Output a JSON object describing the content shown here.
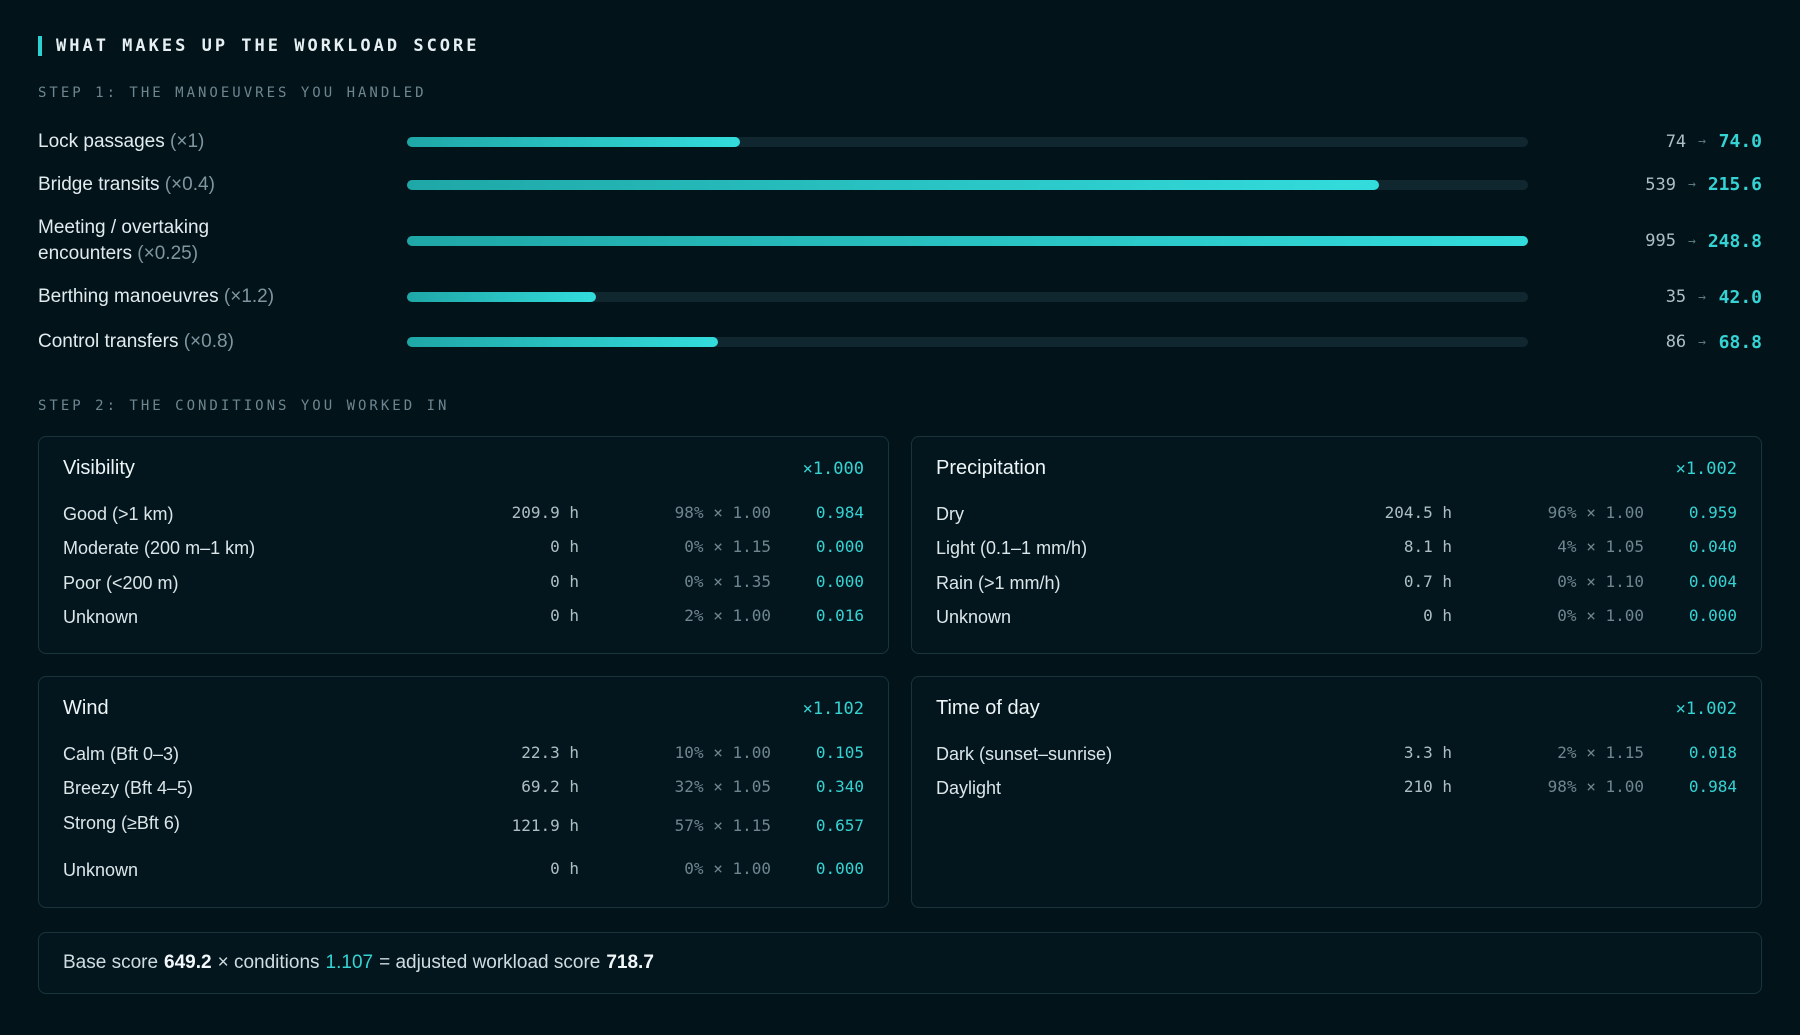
{
  "header": {
    "title": "WHAT MAKES UP THE WORKLOAD SCORE"
  },
  "step1": {
    "label": "STEP 1: THE MANOEUVRES YOU HANDLED",
    "items": [
      {
        "name": "Lock passages",
        "mult": "(×1)",
        "count": "74",
        "result": "74.0",
        "fill_fraction": 0.297
      },
      {
        "name": "Bridge transits",
        "mult": "(×0.4)",
        "count": "539",
        "result": "215.6",
        "fill_fraction": 0.867
      },
      {
        "name": "Meeting / overtaking",
        "name2": "encounters",
        "mult": "(×0.25)",
        "count": "995",
        "result": "248.8",
        "fill_fraction": 1.0
      },
      {
        "name": "Berthing manoeuvres",
        "mult": "(×1.2)",
        "count": "35",
        "result": "42.0",
        "fill_fraction": 0.169
      },
      {
        "name": "Control transfers",
        "mult": "(×0.8)",
        "count": "86",
        "result": "68.8",
        "fill_fraction": 0.277
      }
    ],
    "arrow_glyph": "→"
  },
  "step2": {
    "label": "STEP 2: THE CONDITIONS YOU WORKED IN",
    "cards": [
      {
        "title": "Visibility",
        "multiplier": "×1.000",
        "rows": [
          {
            "label": "Good (>1 km)",
            "hours": "209.9 h",
            "share": "98% × 1.00",
            "value": "0.984"
          },
          {
            "label": "Moderate (200 m–1 km)",
            "hours": "0 h",
            "share": "0% × 1.15",
            "value": "0.000"
          },
          {
            "label": "Poor (<200 m)",
            "hours": "0 h",
            "share": "0% × 1.35",
            "value": "0.000"
          },
          {
            "label": "Unknown",
            "hours": "0 h",
            "share": "2% × 1.00",
            "value": "0.016"
          }
        ]
      },
      {
        "title": "Precipitation",
        "multiplier": "×1.002",
        "rows": [
          {
            "label": "Dry",
            "hours": "204.5 h",
            "share": "96% × 1.00",
            "value": "0.959"
          },
          {
            "label": "Light (0.1–1 mm/h)",
            "hours": "8.1 h",
            "share": "4% × 1.05",
            "value": "0.040"
          },
          {
            "label": "Rain (>1 mm/h)",
            "hours": "0.7 h",
            "share": "0% × 1.10",
            "value": "0.004"
          },
          {
            "label": "Unknown",
            "hours": "0 h",
            "share": "0% × 1.00",
            "value": "0.000"
          }
        ]
      },
      {
        "title": "Wind",
        "multiplier": "×1.102",
        "rows": [
          {
            "label": "Calm (Bft 0–3)",
            "hours": "22.3 h",
            "share": "10% × 1.00",
            "value": "0.105"
          },
          {
            "label": "Breezy (Bft 4–5)",
            "hours": "69.2 h",
            "share": "32% × 1.05",
            "value": "0.340"
          },
          {
            "label": "Strong (≥Bft 6)",
            "hours": "121.9 h",
            "share": "57% × 1.15",
            "value": "0.657"
          },
          {
            "label": "Unknown",
            "hours": "0 h",
            "share": "0% × 1.00",
            "value": "0.000"
          }
        ]
      },
      {
        "title": "Time of day",
        "multiplier": "×1.002",
        "rows": [
          {
            "label": "Dark (sunset–sunrise)",
            "hours": "3.3 h",
            "share": "2% × 1.15",
            "value": "0.018"
          },
          {
            "label": "Daylight",
            "hours": "210 h",
            "share": "98% × 1.00",
            "value": "0.984"
          }
        ]
      }
    ]
  },
  "summary": {
    "base_label": "Base score",
    "base_value": "649.2",
    "times_conditions": "× conditions",
    "conditions_value": "1.107",
    "equals_label": "= adjusted workload score",
    "adjusted_value": "718.7"
  },
  "colors": {
    "accent": "#35d3d3",
    "background": "#03131a",
    "card_border": "#1a343d"
  }
}
